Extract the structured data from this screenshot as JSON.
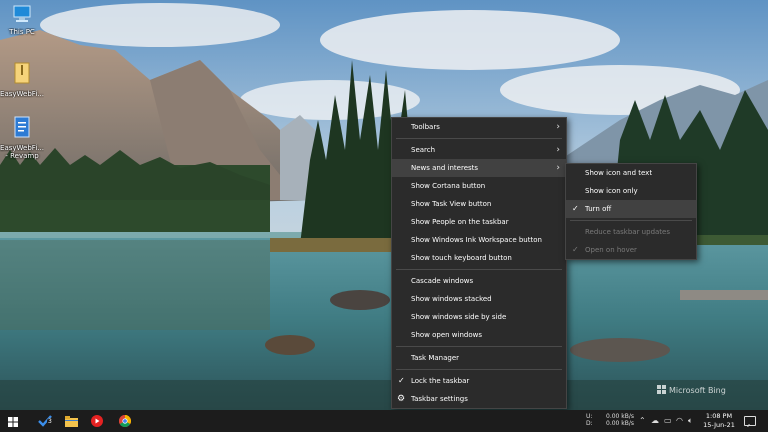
{
  "desktop": {
    "icons": [
      {
        "label": "This PC",
        "icon": "computer-icon"
      },
      {
        "label": "EasyWebFi...",
        "icon": "zip-file-icon"
      },
      {
        "label": "EasyWebFi...",
        "label2": "- Revamp",
        "icon": "document-icon"
      }
    ],
    "watermark": "Microsoft Bing"
  },
  "context_menu": {
    "items": [
      {
        "label": "Toolbars",
        "submenu": true
      },
      {
        "label": "Search",
        "submenu": true
      },
      {
        "label": "News and interests",
        "submenu": true,
        "highlighted": true
      },
      {
        "label": "Show Cortana button"
      },
      {
        "label": "Show Task View button"
      },
      {
        "label": "Show People on the taskbar"
      },
      {
        "label": "Show Windows Ink Workspace button"
      },
      {
        "label": "Show touch keyboard button"
      },
      {
        "label": "Cascade windows"
      },
      {
        "label": "Show windows stacked"
      },
      {
        "label": "Show windows side by side"
      },
      {
        "label": "Show open windows"
      },
      {
        "label": "Task Manager"
      },
      {
        "label": "Lock the taskbar",
        "checked": true
      },
      {
        "label": "Taskbar settings",
        "icon": "gear-icon"
      }
    ]
  },
  "submenu": {
    "items": [
      {
        "label": "Show icon and text"
      },
      {
        "label": "Show icon only"
      },
      {
        "label": "Turn off",
        "checked": true
      },
      {
        "label": "Reduce taskbar updates",
        "disabled": true
      },
      {
        "label": "Open on hover",
        "disabled": true,
        "checked": true
      }
    ]
  },
  "taskbar": {
    "apps": [
      {
        "name": "start",
        "icon": "windows-logo-icon"
      },
      {
        "name": "tasks",
        "icon": "checkmark-app-icon",
        "badge": "3"
      },
      {
        "name": "explorer",
        "icon": "folder-icon"
      },
      {
        "name": "youtube",
        "icon": "youtube-icon"
      },
      {
        "name": "chrome",
        "icon": "chrome-icon"
      }
    ],
    "network": {
      "up_label": "U:",
      "down_label": "D:",
      "up": "0.00 kB/s",
      "down": "0.00 kB/s"
    },
    "clock": {
      "time": "1:08 PM",
      "date": "15-Jun-21"
    }
  },
  "colors": {
    "menu_bg": "#2b2b2b",
    "menu_hover": "#414141",
    "taskbar_bg": "#1c1c1c"
  }
}
